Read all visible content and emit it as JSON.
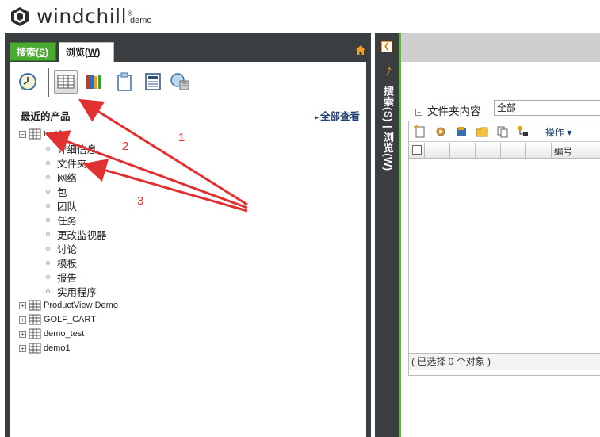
{
  "header": {
    "logo_text": "windchill",
    "logo_tm": "®",
    "user": "demo"
  },
  "nav": {
    "tabs": [
      {
        "label": "搜索(",
        "key": "S",
        "suffix": ")"
      },
      {
        "label": "浏览(",
        "key": "W",
        "suffix": ")"
      }
    ],
    "toolbar_icons": [
      "recent-clock-icon",
      "products-icon",
      "libraries-icon",
      "clipboard-icon",
      "calculator-icon",
      "sites-icon"
    ],
    "section_title": "最近的产品",
    "view_all": "全部查看",
    "tree": [
      {
        "name": "test2",
        "expanded": true,
        "children": [
          "详细信息",
          "文件夹",
          "网络",
          "包",
          "团队",
          "任务",
          "更改监视器",
          "讨论",
          "模板",
          "报告",
          "实用程序"
        ]
      },
      {
        "name": "ProductView Demo",
        "expanded": false
      },
      {
        "name": "GOLF_CART",
        "expanded": false
      },
      {
        "name": "demo_test",
        "expanded": false
      },
      {
        "name": "demo1",
        "expanded": false
      }
    ]
  },
  "vbar": {
    "text": "搜索(S) | 浏览(W)"
  },
  "right": {
    "title": "文件夹内容",
    "select_value": "全部",
    "actions_label": "操作",
    "column_label": "编号",
    "footer": "( 已选择 0 个对象 )"
  },
  "annotations": [
    "1",
    "2",
    "3"
  ],
  "colors": {
    "accent_green": "#4caa32",
    "dark_panel": "#3a3e40",
    "annotation_red": "#e03030"
  }
}
